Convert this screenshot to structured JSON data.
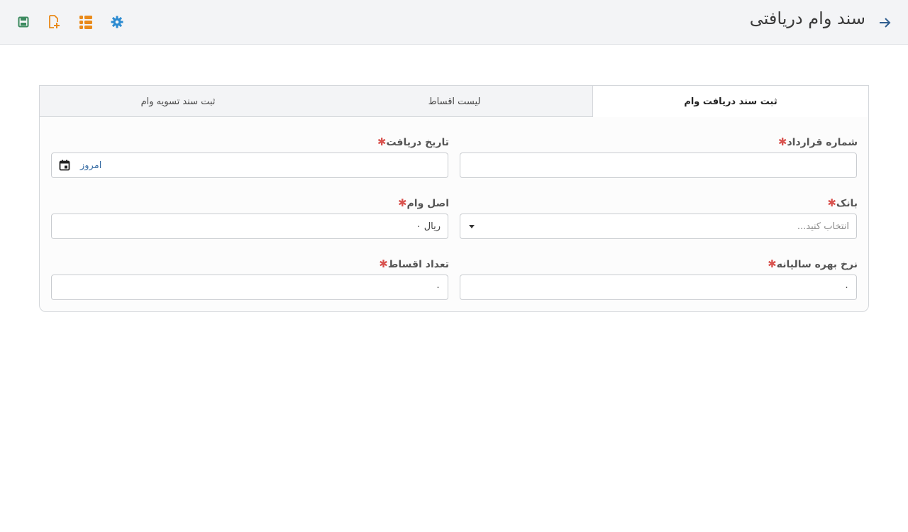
{
  "header": {
    "title": "سند وام دریافتی",
    "back_icon": "arrow-right-icon",
    "toolbar": [
      "save-icon",
      "add-document-icon",
      "list-icon",
      "settings-icon"
    ]
  },
  "tabs": [
    {
      "label": "ثبت سند دریافت وام",
      "active": true
    },
    {
      "label": "لیست اقساط",
      "active": false
    },
    {
      "label": "ثبت سند تسویه وام",
      "active": false
    }
  ],
  "form": {
    "contract_number": {
      "label": "شماره قرارداد",
      "value": ""
    },
    "receive_date": {
      "label": "تاریخ دریافت",
      "value": "امروز"
    },
    "bank": {
      "label": "بانک",
      "placeholder": "انتخاب کنید..."
    },
    "principal": {
      "label": "اصل وام",
      "value": "ریال ۰"
    },
    "annual_rate": {
      "label": "نرخ بهره سالیانه",
      "value": "۰"
    },
    "installments": {
      "label": "تعداد اقساط",
      "value": "۰"
    }
  },
  "required_mark": "✱",
  "colors": {
    "accent": "#3a6ea5",
    "required": "#d9534f",
    "save": "#3c8a5f",
    "orange": "#e98a1a",
    "settings": "#2c8bd1"
  }
}
